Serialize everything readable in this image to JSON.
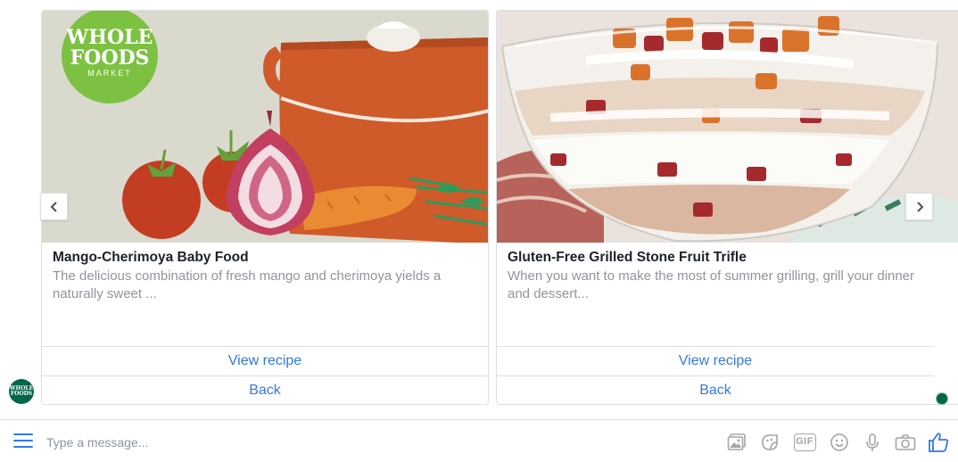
{
  "cards": [
    {
      "title": "Mango-Cherimoya Baby Food",
      "description": "The delicious combination of fresh mango and cherimoya yields a naturally sweet ...",
      "buttons": [
        "View recipe",
        "Back"
      ],
      "logo_line1": "WHOLE",
      "logo_line2": "FOODS",
      "logo_line3": "MARKET",
      "image": "vegetables-pot-illustration"
    },
    {
      "title": "Gluten-Free Grilled Stone Fruit Trifle",
      "description": "When you want to make the most of summer grilling, grill your dinner and dessert...",
      "buttons": [
        "View recipe",
        "Back"
      ],
      "image": "fruit-trifle-photo"
    }
  ],
  "carousel": {
    "prev_icon": "chevron-left-icon",
    "next_icon": "chevron-right-icon"
  },
  "avatar": {
    "line1": "WHOLE",
    "line2": "FOODS"
  },
  "composer": {
    "placeholder": "Type a message...",
    "gif_label": "GIF",
    "icons": [
      "menu-icon",
      "image-icon",
      "sticker-icon",
      "gif-icon",
      "emoji-icon",
      "microphone-icon",
      "camera-icon",
      "thumbs-up-icon"
    ]
  },
  "colors": {
    "accent": "#3578e5",
    "brand_green": "#00674b",
    "logo_green": "#7dc142",
    "pot_orange": "#cf5a2a",
    "muted_text": "#90949c"
  }
}
